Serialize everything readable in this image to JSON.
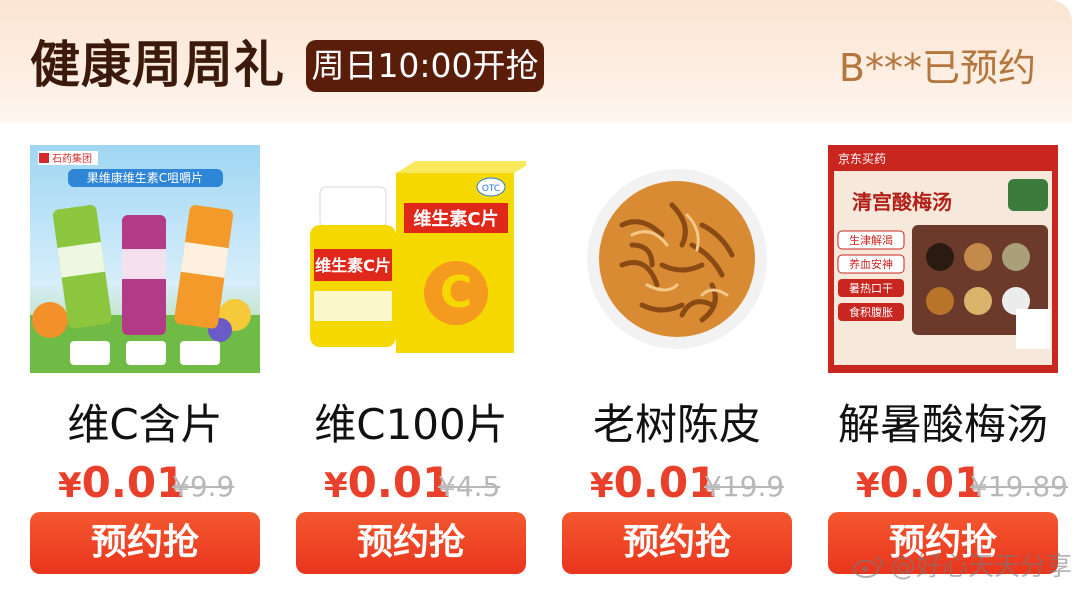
{
  "header": {
    "title": "健康周周礼",
    "time_badge": "周日10:00开抢",
    "reserved_text": "B***已预约"
  },
  "products": [
    {
      "name": "维C含片",
      "currency": "¥",
      "price": "0.01",
      "original_price": "¥9.9",
      "button": "预约抢",
      "image_label": "果维康维生素C咀嚼片",
      "brand": "石药集团"
    },
    {
      "name": "维C100片",
      "currency": "¥",
      "price": "0.01",
      "original_price": "¥4.5",
      "button": "预约抢",
      "image_label": "维生素C片",
      "tag": "OTC"
    },
    {
      "name": "老树陈皮",
      "currency": "¥",
      "price": "0.01",
      "original_price": "¥19.9",
      "button": "预约抢"
    },
    {
      "name": "解暑酸梅汤",
      "currency": "¥",
      "price": "0.01",
      "original_price": "¥19.89",
      "button": "预约抢",
      "image_label": "清宫酸梅汤",
      "brand": "京东买药",
      "tags": [
        "生津解渴",
        "养血安神",
        "暑热口干",
        "食积腹胀"
      ]
    }
  ],
  "watermark": "@好心天天分享",
  "colors": {
    "accent": "#e8402a",
    "button": "#ee4423",
    "title": "#3b1a0c",
    "badge": "#5a1d0a",
    "reserved": "#b4763c"
  }
}
